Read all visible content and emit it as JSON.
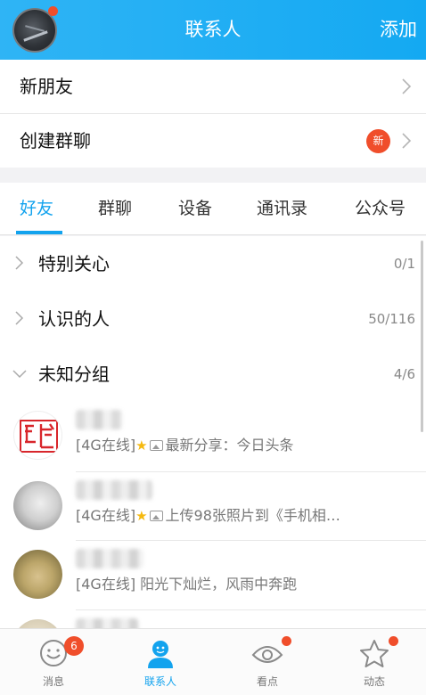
{
  "header": {
    "title": "联系人",
    "action": "添加"
  },
  "menu": {
    "new_friends": "新朋友",
    "create_group": "创建群聊",
    "new_badge": "新"
  },
  "tabs": [
    "好友",
    "群聊",
    "设备",
    "通讯录",
    "公众号"
  ],
  "active_tab": "好友",
  "groups": [
    {
      "name": "特别关心",
      "count": "0/1",
      "expanded": false
    },
    {
      "name": "认识的人",
      "count": "50/116",
      "expanded": false
    },
    {
      "name": "未知分组",
      "count": "4/6",
      "expanded": true
    }
  ],
  "contacts": [
    {
      "status_prefix": "[4G在线]",
      "has_star": true,
      "has_image_icon": true,
      "status_text": "最新分享：今日头条"
    },
    {
      "status_prefix": "[4G在线]",
      "has_star": true,
      "has_image_icon": true,
      "status_text": "上传98张照片到《手机相…"
    },
    {
      "status_prefix": "[4G在线]",
      "has_star": false,
      "has_image_icon": false,
      "status_text": "阳光下灿烂，风雨中奔跑"
    }
  ],
  "bottom_nav": {
    "items": [
      {
        "label": "消息",
        "icon": "message-smile-icon",
        "badge": "6"
      },
      {
        "label": "联系人",
        "icon": "contacts-person-icon"
      },
      {
        "label": "看点",
        "icon": "eye-icon"
      },
      {
        "label": "动态",
        "icon": "star-icon"
      }
    ],
    "active": "联系人"
  },
  "colors": {
    "accent": "#13a3ee",
    "badge": "#f04e2b",
    "header_start": "#2fb4f5",
    "header_end": "#14a9f2"
  }
}
